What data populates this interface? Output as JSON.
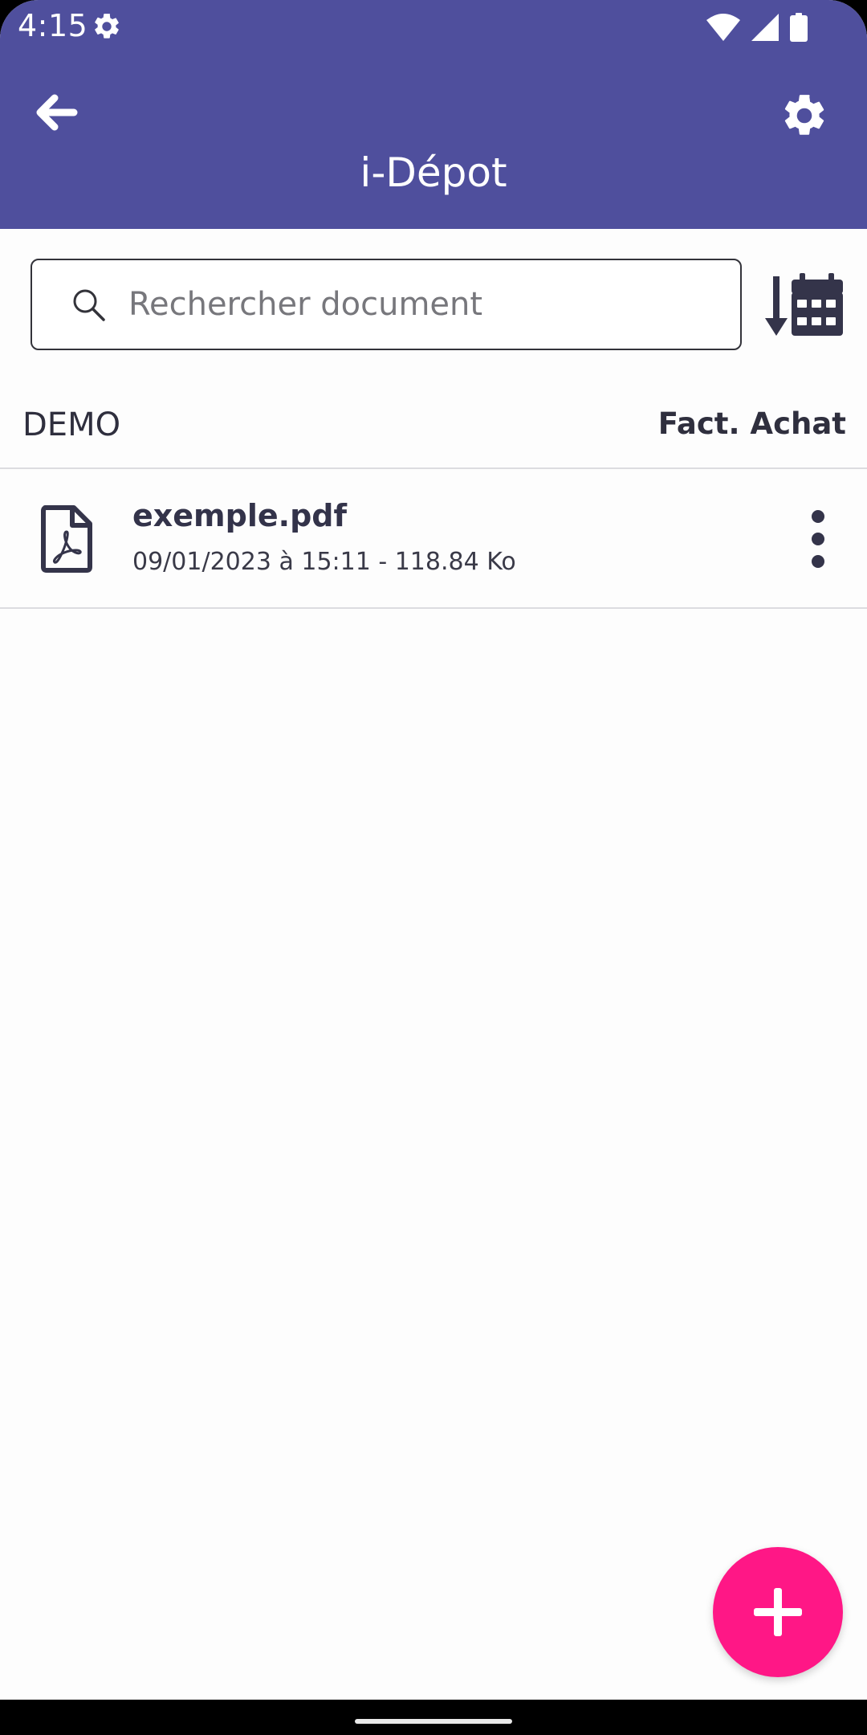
{
  "status_bar": {
    "time": "4:15",
    "icons": [
      "settings-icon",
      "wifi-icon",
      "signal-icon",
      "battery-icon"
    ]
  },
  "app_bar": {
    "title": "i-Dépot",
    "back_icon": "arrow-left-icon",
    "settings_icon": "gear-icon",
    "background_color": "#4f4f9d"
  },
  "search": {
    "placeholder": "Rechercher document",
    "value": "",
    "icon": "search-icon"
  },
  "sort": {
    "icon": "sort-by-date-icon"
  },
  "section": {
    "left_label": "DEMO",
    "right_label": "Fact. Achat"
  },
  "documents": [
    {
      "name": "exemple.pdf",
      "meta": "09/01/2023 à 15:11 - 118.84 Ko",
      "icon": "pdf-file-icon"
    }
  ],
  "fab": {
    "icon": "plus-icon",
    "color": "#ff1786"
  }
}
